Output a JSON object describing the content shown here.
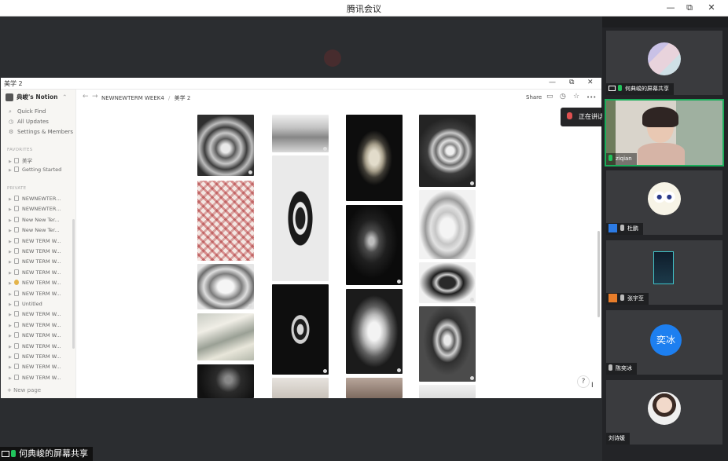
{
  "window": {
    "title": "腾讯会议",
    "controls": {
      "min": "—",
      "restore": "⧉",
      "close": "✕"
    }
  },
  "shared_screen": {
    "window_title": "美学 2",
    "controls": {
      "min": "—",
      "restore": "⧉",
      "close": "✕"
    },
    "sidebar": {
      "workspace": "典峻's Notion",
      "workspace_caret": "⌃",
      "links": [
        {
          "icon": "⌕",
          "label": "Quick Find"
        },
        {
          "icon": "◷",
          "label": "All Updates"
        },
        {
          "icon": "⚙",
          "label": "Settings & Members"
        }
      ],
      "favorites_title": "FAVORITES",
      "favorites": [
        "美学",
        "Getting Started"
      ],
      "private_title": "PRIVATE",
      "private_items": [
        "NEWNEWTER...",
        "NEWNEWTER...",
        "New New Ter...",
        "New New Ter...",
        "NEW TERM W...",
        "NEW TERM W...",
        "NEW TERM W...",
        "NEW TERM W...",
        "NEW TERM W...",
        "NEW TERM W...",
        "Untitled",
        "NEW TERM W...",
        "NEW TERM W...",
        "NEW TERM W...",
        "NEW TERM W...",
        "NEW TERM W...",
        "NEW TERM W...",
        "NEW TERM W..."
      ],
      "new_page": "New page"
    },
    "page": {
      "back": "←",
      "forward": "→",
      "breadcrumb": [
        "NEWNEWTERM WEEK4",
        "/",
        "美学 2"
      ],
      "share": "Share",
      "icons": {
        "comment": "▭",
        "updates": "◷",
        "favorite": "☆",
        "more": "•••"
      },
      "help": "?",
      "cursor": "I"
    }
  },
  "speaking_indicator": "正在讲话: 何典峻; ziqian;",
  "participants": [
    {
      "label": "何典峻的屏幕共享",
      "kind": "screen"
    },
    {
      "label": "ziqian",
      "kind": "video"
    },
    {
      "label": "杜鹏",
      "kind": "avatar"
    },
    {
      "label": "张宇至",
      "kind": "avatar"
    },
    {
      "label": "陈奕冰",
      "kind": "text",
      "initials": "奕冰"
    },
    {
      "label": "刘诗媛",
      "kind": "avatar"
    }
  ],
  "sharing_status": "何典峻的屏幕共享"
}
